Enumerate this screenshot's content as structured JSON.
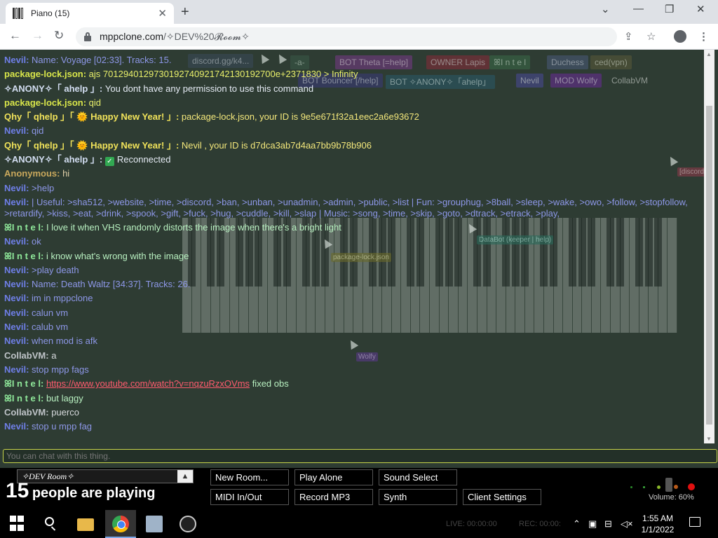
{
  "browser": {
    "tab_title": "Piano (15)",
    "url_host": "mppclone.com",
    "url_path": "/✧DEV%20𝓡𝓸𝓸𝓶✧"
  },
  "tags": [
    {
      "label": "discord.gg/k4...",
      "color": "#3a4a5a",
      "text": "#c8d0e0"
    },
    {
      "label": "-a-",
      "color": "#3a5a48",
      "text": "#c8e0d0"
    },
    {
      "label": "BOT  Theta [=help]",
      "color": "#7a3a8a",
      "text": "#f0c8f5"
    },
    {
      "label": "OWNER  Lapis",
      "color": "#8a2a3a",
      "text": "#f0c8d0"
    },
    {
      "label": "ꕤI n t e l",
      "color": "#3a6a48",
      "text": "#d0f0d8"
    },
    {
      "label": "Duchess",
      "color": "#4a5a7a",
      "text": "#d0d8f0"
    },
    {
      "label": "ced(vpn)",
      "color": "#5a5a3a",
      "text": "#e0e0c8"
    },
    {
      "label": "BOT  Bouncer [/help]",
      "color": "#3a3a7a",
      "text": "#d0d0f5"
    },
    {
      "label": "BOT  ✧ANONY✧「ahelp」",
      "color": "#2a5a6a",
      "text": "#c8e8f0"
    },
    {
      "label": "Nevil",
      "color": "#4a4a9a",
      "text": "#e0e0ff"
    },
    {
      "label": "MOD  Wolfy",
      "color": "#6a2a9a",
      "text": "#e8c8ff"
    },
    {
      "label": "CollabVM",
      "color": "#2e3c33",
      "text": "#e0e4e0"
    }
  ],
  "chat": [
    {
      "nick": "Nevil",
      "nclass": "nevil",
      "text": "Name: Voyage [02:33]. Tracks: 15.",
      "tclass": "t-nevil"
    },
    {
      "nick": "package-lock.json",
      "nclass": "pkg",
      "text": "ajs 7012940129730192740921742130192700e+2371830 > Infinity",
      "tclass": "t-pkg"
    },
    {
      "nick": "✧ANONY✧「 ahelp 」",
      "nclass": "anony",
      "text": "You dont have any permission to use this command",
      "tclass": "t-anony"
    },
    {
      "nick": "package-lock.json",
      "nclass": "pkg",
      "text": "qid",
      "tclass": "t-pkg"
    },
    {
      "nick": "Qhy「 qhelp 」「 🌞 Happy New Year! 」",
      "nclass": "qhy",
      "text": "package-lock.json, your ID is 9e5e671f32a1eec2a6e93672",
      "tclass": "t-qhy"
    },
    {
      "nick": "Nevil",
      "nclass": "nevil",
      "text": "qid",
      "tclass": "t-nevil"
    },
    {
      "nick": "Qhy「 qhelp 」「 🌞 Happy New Year! 」",
      "nclass": "qhy",
      "text": "Nevil , your ID is d7dca3ab7d4aa7bb9b78b906",
      "tclass": "t-qhy"
    },
    {
      "nick": "✧ANONY✧「 ahelp 」",
      "nclass": "anony",
      "text": "Reconnected",
      "tclass": "t-anony",
      "check": true
    },
    {
      "nick": "Anonymous",
      "nclass": "anon",
      "text": "hi",
      "tclass": "t-anon"
    },
    {
      "nick": "Nevil",
      "nclass": "nevil",
      "text": ">help",
      "tclass": "t-nevil"
    },
    {
      "nick": "Nevil",
      "nclass": "nevil",
      "text": "| Useful: >sha512, >website, >time, >discord, >ban, >unban, >unadmin, >admin, >public, >list | Fun: >grouphug, >8ball, >sleep, >wake, >owo, >follow, >stopfollow, >retardify, >kiss, >eat, >drink, >spook, >gift, >fuck, >hug, >cuddle, >kill, >slap | Music: >song, >time, >skip, >goto, >dtrack, >etrack, >play,",
      "tclass": "t-nevil",
      "wrap": true
    },
    {
      "nick": "ꕤI n t e l",
      "nclass": "intel",
      "text": "I love it when VHS randomly distorts the image when there's a bright light",
      "tclass": "t-intel"
    },
    {
      "nick": "Nevil",
      "nclass": "nevil",
      "text": "ok",
      "tclass": "t-nevil"
    },
    {
      "nick": "ꕤI n t e l",
      "nclass": "intel",
      "text": "i know what's wrong with the image",
      "tclass": "t-intel"
    },
    {
      "nick": "Nevil",
      "nclass": "nevil",
      "text": ">play death",
      "tclass": "t-nevil"
    },
    {
      "nick": "Nevil",
      "nclass": "nevil",
      "text": "Name: Death Waltz [34:37]. Tracks: 26.",
      "tclass": "t-nevil"
    },
    {
      "nick": "Nevil",
      "nclass": "nevil",
      "text": "im in mppclone",
      "tclass": "t-nevil"
    },
    {
      "nick": "Nevil",
      "nclass": "nevil",
      "text": "calun vm",
      "tclass": "t-nevil"
    },
    {
      "nick": "Nevil",
      "nclass": "nevil",
      "text": "calub vm",
      "tclass": "t-nevil"
    },
    {
      "nick": "Nevil",
      "nclass": "nevil",
      "text": "when mod is afk",
      "tclass": "t-nevil"
    },
    {
      "nick": "CollabVM",
      "nclass": "collab",
      "text": "a",
      "tclass": "t-collab"
    },
    {
      "nick": "Nevil",
      "nclass": "nevil",
      "text": "stop mpp fags",
      "tclass": "t-nevil"
    },
    {
      "nick": "ꕤI n t e l",
      "nclass": "intel",
      "text": "fixed obs",
      "tclass": "t-intel",
      "link": "https://www.youtube.com/watch?v=nqzuRzxOVms"
    },
    {
      "nick": "ꕤI n t e l",
      "nclass": "intel",
      "text": "but laggy",
      "tclass": "t-intel"
    },
    {
      "nick": "CollabVM",
      "nclass": "collab",
      "text": "puerco",
      "tclass": "t-collab"
    },
    {
      "nick": "Nevil",
      "nclass": "nevil",
      "text": "stop u mpp fag",
      "tclass": "t-nevil"
    }
  ],
  "cursor_labels": [
    {
      "label": "package-lock.json",
      "color": "#a0a040"
    },
    {
      "label": "DataBot (keeper | help)",
      "color": "#2a6a5a"
    },
    {
      "label": "Wolfy",
      "color": "#6a3a9a"
    },
    {
      "label": "[discord]",
      "color": "#8a3a4a"
    }
  ],
  "chat_input_placeholder": "You can chat with this thing.",
  "room": {
    "name": "✧DEV Room✧",
    "arrow": "▲"
  },
  "player_count": {
    "number": "15",
    "label": "people are playing"
  },
  "buttons": {
    "new_room": "New Room...",
    "play_alone": "Play Alone",
    "sound_select": "Sound Select",
    "midi": "MIDI In/Out",
    "record_mp3": "Record MP3",
    "synth": "Synth",
    "client_settings": "Client Settings"
  },
  "volume_label": "Volume: 60%",
  "taskbar": {
    "live": "LIVE: 00:00:00",
    "rec": "REC: 00:00:",
    "time": "1:55 AM",
    "date": "1/1/2022"
  },
  "colors": {
    "accent_green": "#c8d44a",
    "record_red": "#e01010"
  }
}
